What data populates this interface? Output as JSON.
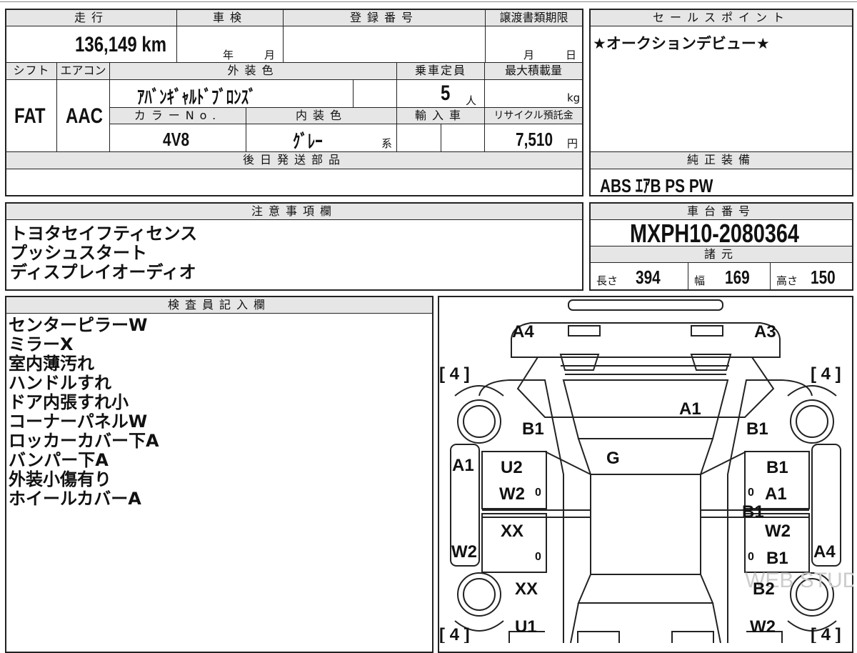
{
  "mileage": {
    "label": "走行",
    "value": "136,149 km"
  },
  "inspection": {
    "label": "車検",
    "year_unit": "年",
    "month_unit": "月"
  },
  "registration": {
    "label": "登録番号"
  },
  "transfer_deadline": {
    "label": "譲渡書類期限",
    "month_unit": "月",
    "day_unit": "日"
  },
  "sales_point": {
    "label": "セールスポイント",
    "text": "★オークションデビュー★"
  },
  "shift": {
    "label": "シフト",
    "value": "FAT"
  },
  "aircon": {
    "label": "エアコン",
    "value": "AAC"
  },
  "exterior_color": {
    "label": "外装色",
    "value": "ｱﾊﾞﾝｷﾞｬﾙﾄﾞﾌﾞﾛﾝｽﾞ"
  },
  "capacity": {
    "label": "乗車定員",
    "value": "5",
    "unit": "人"
  },
  "max_load": {
    "label": "最大積載量",
    "unit": "kg"
  },
  "color_no": {
    "label": "カラーNo.",
    "value": "4V8"
  },
  "interior_color": {
    "label": "内装色",
    "value": "ｸﾞﾚｰ",
    "suffix": "系"
  },
  "import": {
    "label": "輸入車"
  },
  "recycle": {
    "label": "リサイクル預託金",
    "value": "7,510",
    "unit": "円"
  },
  "later_parts": {
    "label": "後日発送部品"
  },
  "genuine_equipment": {
    "label": "純正装備",
    "value": "ABS ｴｱB PS PW"
  },
  "notes": {
    "label": "注意事項欄",
    "lines": [
      "トヨタセイフティセンス",
      "プッシュスタート",
      "ディスプレイオーディオ"
    ]
  },
  "chassis": {
    "label": "車台番号",
    "value": "MXPH10-2080364"
  },
  "specs": {
    "label": "諸元",
    "length_label": "長さ",
    "length": "394",
    "width_label": "幅",
    "width": "169",
    "height_label": "高さ",
    "height": "150"
  },
  "inspector": {
    "label": "検査員記入欄",
    "lines": [
      "センターピラーW",
      "ミラーX",
      "室内薄汚れ",
      "ハンドルすれ",
      "ドア内張すれ小",
      "コーナーパネルW",
      "ロッカーカバー下A",
      "バンパー下A",
      "外装小傷有り",
      "ホイールカバーA"
    ]
  },
  "diagram": {
    "tire_marks": [
      "[ 4 ]",
      "[ 4 ]",
      "[ 4 ]",
      "[ 4 ]"
    ],
    "labels": [
      "A4",
      "A3",
      "A1",
      "B1",
      "B1",
      "G",
      "A1",
      "U2",
      "W2",
      "B1",
      "A1",
      "B1",
      "W2",
      "XX",
      "W2",
      "B1",
      "A4",
      "XX",
      "B2",
      "U1",
      "W2"
    ],
    "zeros": [
      "0",
      "0",
      "0",
      "0"
    ],
    "watermark": "WEB STUDIO"
  }
}
